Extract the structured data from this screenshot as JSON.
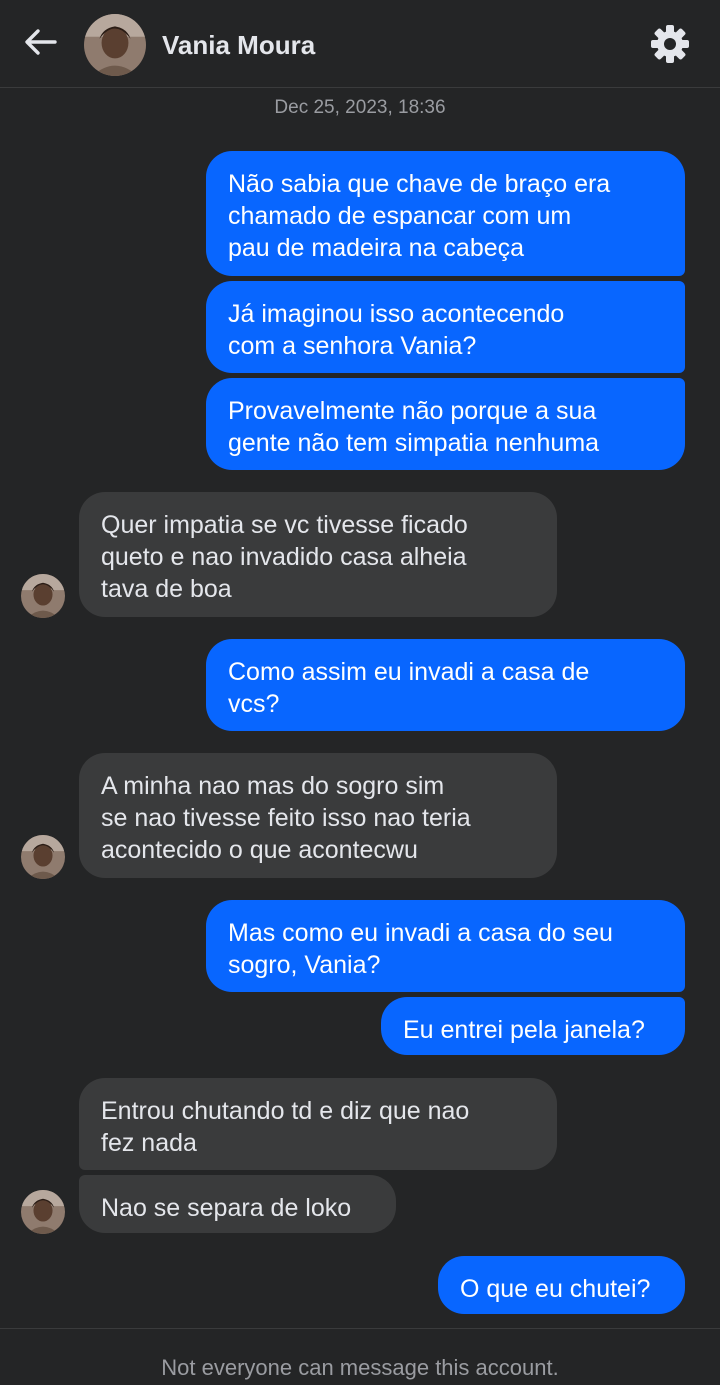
{
  "header": {
    "back_icon": "arrow-left-icon",
    "contact_name": "Vania Moura",
    "settings_icon": "gear-icon"
  },
  "conversation": {
    "timestamp": "Dec 25, 2023, 18:36",
    "messages": [
      {
        "direction": "outgoing",
        "text": "Não sabia que chave de braço era\nchamado de espancar com um\npau de madeira na cabeça"
      },
      {
        "direction": "outgoing",
        "text": "Já imaginou isso acontecendo\ncom a senhora Vania?"
      },
      {
        "direction": "outgoing",
        "text": "Provavelmente não porque a sua\ngente não tem simpatia nenhuma"
      },
      {
        "direction": "incoming",
        "text": "Quer impatia se vc tivesse ficado\nqueto e nao invadido casa alheia\ntava de boa"
      },
      {
        "direction": "outgoing",
        "text": "Como assim eu invadi a casa de\nvcs?"
      },
      {
        "direction": "incoming",
        "text": "A minha nao mas do sogro sim\nse nao tivesse feito isso nao teria\nacontecido o que acontecwu"
      },
      {
        "direction": "outgoing",
        "text": "Mas como eu invadi a casa do seu\nsogro, Vania?"
      },
      {
        "direction": "outgoing",
        "text": "Eu entrei pela janela?"
      },
      {
        "direction": "incoming",
        "text": "Entrou chutando td e diz que nao\nfez nada"
      },
      {
        "direction": "incoming",
        "text": "Nao se separa de loko"
      },
      {
        "direction": "outgoing",
        "text": "O que eu chutei?"
      }
    ]
  },
  "footer": {
    "notice": "Not everyone can message this account."
  },
  "colors": {
    "background": "#242526",
    "outgoing_bubble": "#0866ff",
    "incoming_bubble": "#3a3b3c",
    "muted_text": "#9a9ca1"
  }
}
